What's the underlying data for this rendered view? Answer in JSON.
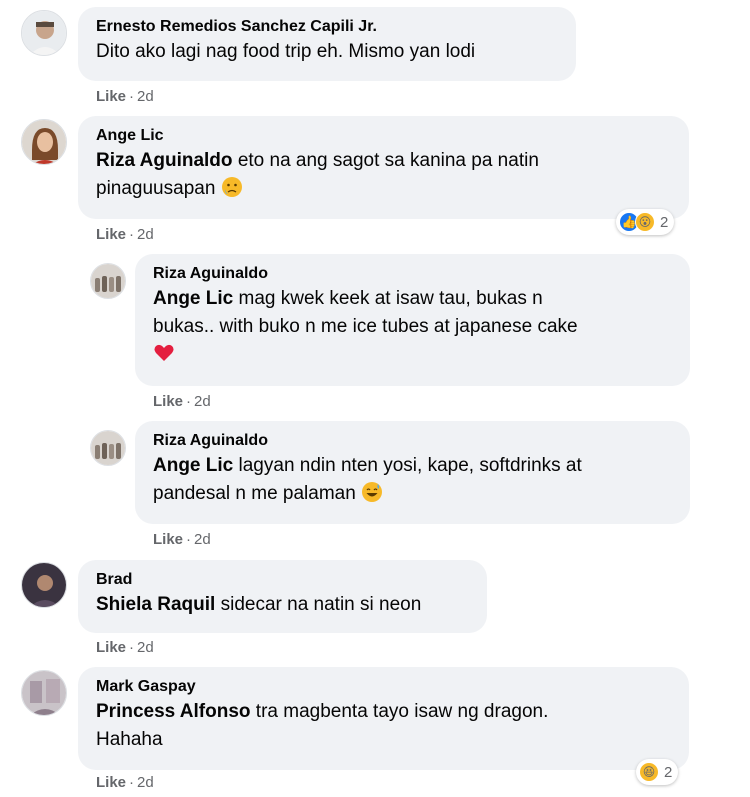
{
  "comments": [
    {
      "author": "Ernesto Remedios Sanchez Capili Jr.",
      "text": "Dito ako lagi nag food trip eh. Mismo yan lodi",
      "like_label": "Like",
      "time": "2d"
    },
    {
      "author": "Ange Lic",
      "mention": "Riza Aguinaldo",
      "text": "eto na ang sagot sa kanina pa natin",
      "text2": "pinaguusapan",
      "emoji": "crying-face",
      "like_label": "Like",
      "time": "2d",
      "reactions": {
        "types": [
          "like",
          "wow"
        ],
        "count": "2"
      }
    },
    {
      "author": "Riza Aguinaldo",
      "mention": "Ange Lic",
      "text": "mag kwek keek at isaw tau, bukas n",
      "text2": "bukas.. with buko n me ice tubes at japanese cake",
      "emoji": "red-heart",
      "like_label": "Like",
      "time": "2d"
    },
    {
      "author": "Riza Aguinaldo",
      "mention": "Ange Lic",
      "text": "lagyan ndin nten yosi, kape, softdrinks at",
      "text2": "pandesal n me palaman",
      "emoji": "grinning-sweat-face",
      "like_label": "Like",
      "time": "2d"
    },
    {
      "author": "Brad",
      "mention": "Shiela Raquil",
      "text": "sidecar na natin si neon",
      "like_label": "Like",
      "time": "2d"
    },
    {
      "author": "Mark Gaspay",
      "mention": "Princess Alfonso",
      "text": "tra magbenta tayo isaw ng dragon.",
      "text2": "Hahaha",
      "like_label": "Like",
      "time": "2d",
      "reactions": {
        "types": [
          "haha"
        ],
        "count": "2"
      }
    }
  ],
  "separator": "·",
  "colors": {
    "bubble": "#f0f2f5",
    "meta_text": "#65676b",
    "like_reaction": "#1877f2",
    "emoji_yellow": "#f7b928",
    "heart_red": "#e41e3f"
  }
}
